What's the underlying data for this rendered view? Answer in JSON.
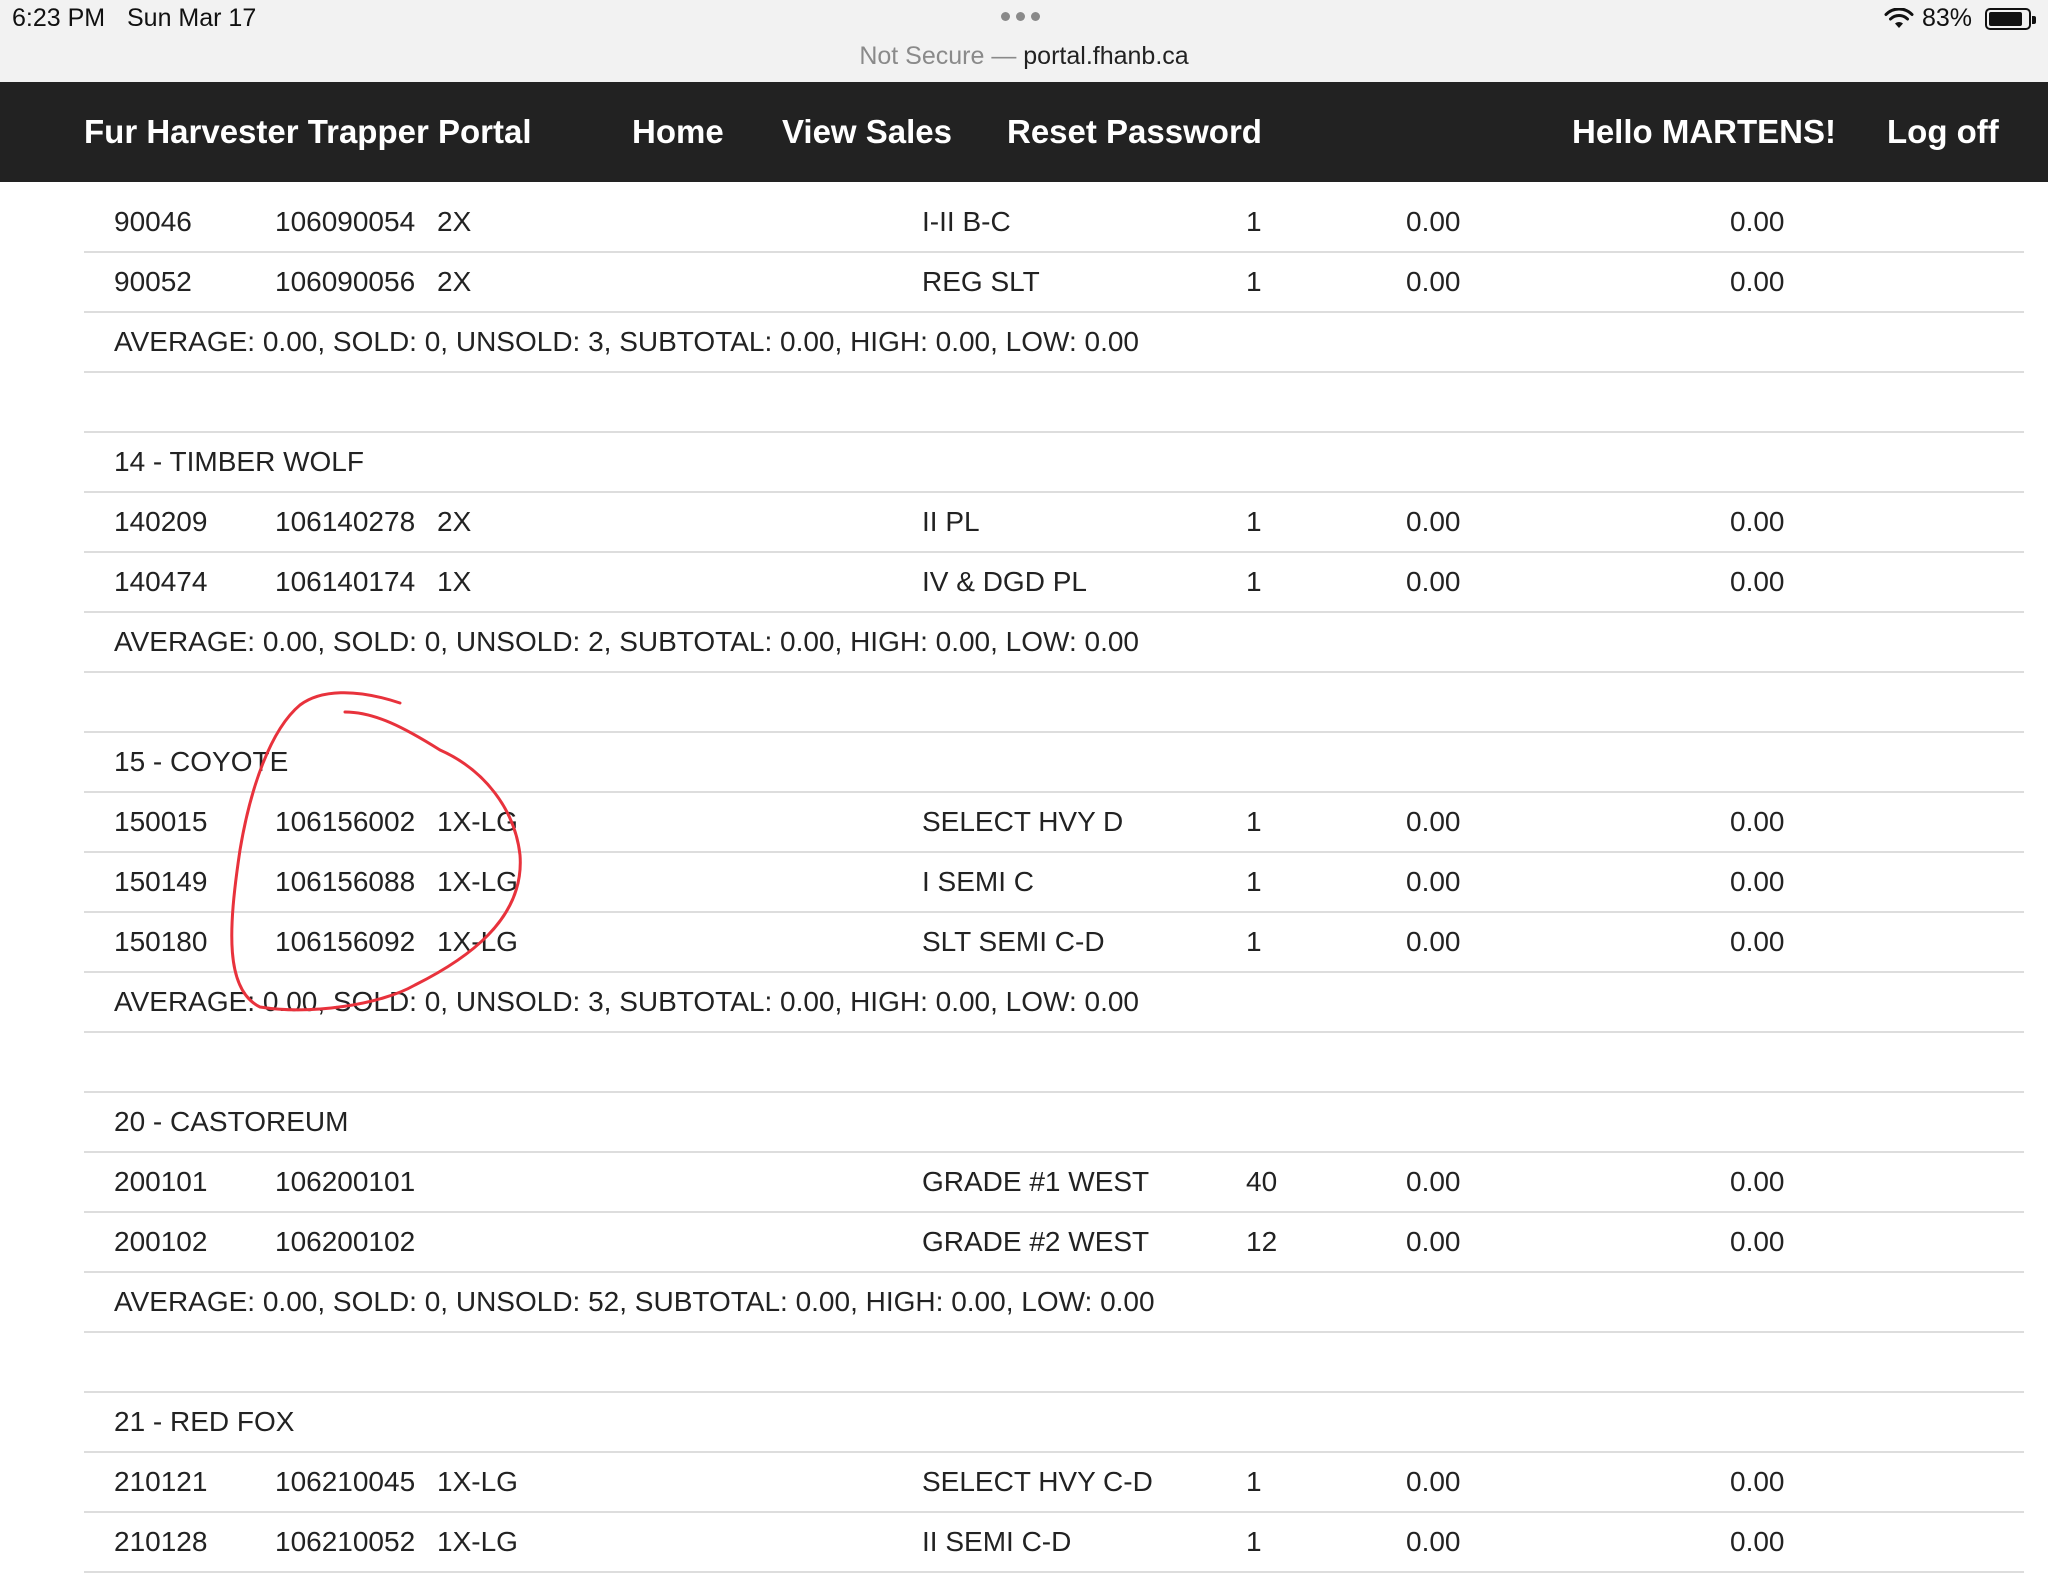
{
  "status_bar": {
    "time": "6:23 PM",
    "date": "Sun Mar 17",
    "url_prefix": "Not Secure —",
    "url_host": "portal.fhanb.ca",
    "battery_percent": "83%",
    "battery_level": 0.83
  },
  "navbar": {
    "brand": "Fur Harvester Trapper Portal",
    "home": "Home",
    "view_sales": "View Sales",
    "reset_password": "Reset Password",
    "greeting": "Hello MARTENS!",
    "logoff": "Log off"
  },
  "rows": [
    {
      "type": "item",
      "lot": "90046",
      "tag": "106090054",
      "size": "2X",
      "grade": "I-II B-C",
      "qty": "1",
      "price": "0.00",
      "total": "0.00"
    },
    {
      "type": "item",
      "lot": "90052",
      "tag": "106090056",
      "size": "2X",
      "grade": "REG SLT",
      "qty": "1",
      "price": "0.00",
      "total": "0.00"
    },
    {
      "type": "summary",
      "text": "AVERAGE: 0.00, SOLD: 0, UNSOLD: 3, SUBTOTAL: 0.00, HIGH: 0.00, LOW: 0.00"
    },
    {
      "type": "spacer"
    },
    {
      "type": "header",
      "text": "14 - TIMBER WOLF"
    },
    {
      "type": "item",
      "lot": "140209",
      "tag": "106140278",
      "size": "2X",
      "grade": "II PL",
      "qty": "1",
      "price": "0.00",
      "total": "0.00"
    },
    {
      "type": "item",
      "lot": "140474",
      "tag": "106140174",
      "size": "1X",
      "grade": "IV & DGD PL",
      "qty": "1",
      "price": "0.00",
      "total": "0.00"
    },
    {
      "type": "summary",
      "text": "AVERAGE: 0.00, SOLD: 0, UNSOLD: 2, SUBTOTAL: 0.00, HIGH: 0.00, LOW: 0.00"
    },
    {
      "type": "spacer"
    },
    {
      "type": "header",
      "text": "15 - COYOTE"
    },
    {
      "type": "item",
      "lot": "150015",
      "tag": "106156002",
      "size": "1X-LG",
      "grade": "SELECT HVY D",
      "qty": "1",
      "price": "0.00",
      "total": "0.00"
    },
    {
      "type": "item",
      "lot": "150149",
      "tag": "106156088",
      "size": "1X-LG",
      "grade": "I SEMI C",
      "qty": "1",
      "price": "0.00",
      "total": "0.00"
    },
    {
      "type": "item",
      "lot": "150180",
      "tag": "106156092",
      "size": "1X-LG",
      "grade": "SLT SEMI C-D",
      "qty": "1",
      "price": "0.00",
      "total": "0.00"
    },
    {
      "type": "summary",
      "text": "AVERAGE: 0.00, SOLD: 0, UNSOLD: 3, SUBTOTAL: 0.00, HIGH: 0.00, LOW: 0.00"
    },
    {
      "type": "spacer"
    },
    {
      "type": "header",
      "text": "20 - CASTOREUM"
    },
    {
      "type": "item",
      "lot": "200101",
      "tag": "106200101",
      "size": "",
      "grade": "GRADE #1 WEST",
      "qty": "40",
      "price": "0.00",
      "total": "0.00"
    },
    {
      "type": "item",
      "lot": "200102",
      "tag": "106200102",
      "size": "",
      "grade": "GRADE #2 WEST",
      "qty": "12",
      "price": "0.00",
      "total": "0.00"
    },
    {
      "type": "summary",
      "text": "AVERAGE: 0.00, SOLD: 0, UNSOLD: 52, SUBTOTAL: 0.00, HIGH: 0.00, LOW: 0.00"
    },
    {
      "type": "spacer"
    },
    {
      "type": "header",
      "text": "21 - RED FOX"
    },
    {
      "type": "item",
      "lot": "210121",
      "tag": "106210045",
      "size": "1X-LG",
      "grade": "SELECT HVY C-D",
      "qty": "1",
      "price": "0.00",
      "total": "0.00"
    },
    {
      "type": "item",
      "lot": "210128",
      "tag": "106210052",
      "size": "1X-LG",
      "grade": "II SEMI C-D",
      "qty": "1",
      "price": "0.00",
      "total": "0.00"
    }
  ],
  "annotation_color": "#e8323c",
  "colors": {
    "navbar": "#222222",
    "divider": "#dddddd",
    "text": "#222222"
  }
}
